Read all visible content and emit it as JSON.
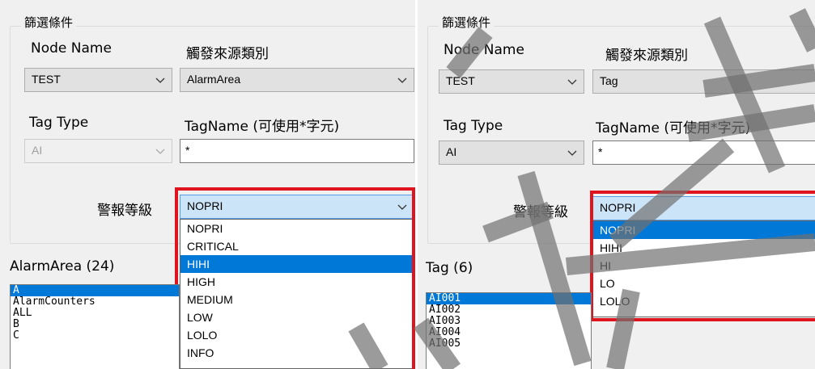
{
  "left": {
    "group_title": "篩選條件",
    "node_name_label": "Node Name",
    "node_name_value": "TEST",
    "trigger_source_label": "觸發來源類別",
    "trigger_source_value": "AlarmArea",
    "tag_type_label": "Tag Type",
    "tag_type_value": "AI",
    "tag_type_enabled": false,
    "tagname_label": "TagName (可使用*字元)",
    "tagname_value": "*",
    "alarm_level_label": "警報等級",
    "alarm_level_value": "NOPRI",
    "alarm_level_options": [
      "NOPRI",
      "CRITICAL",
      "HIHI",
      "HIGH",
      "MEDIUM",
      "LOW",
      "LOLO",
      "INFO"
    ],
    "alarm_level_highlighted": "HIHI",
    "list_label": "AlarmArea (24)",
    "list_items": [
      "A",
      "AlarmCounters",
      "ALL",
      "B",
      "C"
    ],
    "list_selected": "A"
  },
  "right": {
    "group_title": "篩選條件",
    "node_name_label": "Node Name",
    "node_name_value": "TEST",
    "trigger_source_label": "觸發來源類別",
    "trigger_source_value": "Tag",
    "tag_type_label": "Tag Type",
    "tag_type_value": "AI",
    "tag_type_enabled": true,
    "tagname_label": "TagName (可使用*字元)",
    "tagname_value": "*",
    "alarm_level_label": "警報等級",
    "alarm_level_value": "NOPRI",
    "alarm_level_options": [
      "NOPRI",
      "HIHI",
      "HI",
      "LO",
      "LOLO"
    ],
    "alarm_level_highlighted": "NOPRI",
    "list_label": "Tag (6)",
    "list_items": [
      "AI001",
      "AI002",
      "AI003",
      "AI004",
      "AI005"
    ],
    "list_selected": "AI001"
  },
  "colors": {
    "window_bg": "#f0f0f0",
    "selection_blue": "#0078d7",
    "highlight_frame_red": "#e0141e",
    "focused_combo_bg": "#cce4f7",
    "watermark_gray": "#707070"
  },
  "icons": {
    "dropdown_arrow": "chevron-down-icon"
  }
}
